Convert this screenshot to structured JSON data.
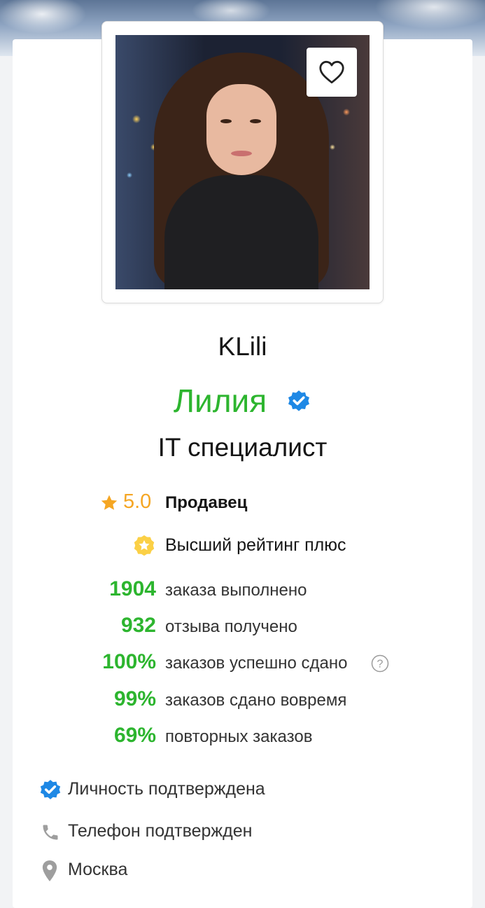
{
  "profile": {
    "username": "KLili",
    "real_name": "Лилия",
    "profession": "IT специалист",
    "rating": "5.0",
    "role": "Продавец",
    "top_rating": "Высший рейтинг плюс"
  },
  "stats": [
    {
      "value": "1904",
      "label": "заказа выполнено"
    },
    {
      "value": "932",
      "label": "отзыва получено"
    },
    {
      "value": "100%",
      "label": "заказов успешно сдано"
    },
    {
      "value": "99%",
      "label": "заказов сдано вовремя"
    },
    {
      "value": "69%",
      "label": "повторных заказов"
    }
  ],
  "verifications": [
    {
      "icon": "verified-check-icon",
      "label": "Личность подтверждена"
    },
    {
      "icon": "phone-icon",
      "label": "Телефон подтвержден"
    },
    {
      "icon": "location-pin-icon",
      "label": "Москва"
    }
  ],
  "colors": {
    "accent_green": "#2db52f",
    "rating_orange": "#f5a623",
    "verified_blue": "#1e88e5"
  }
}
